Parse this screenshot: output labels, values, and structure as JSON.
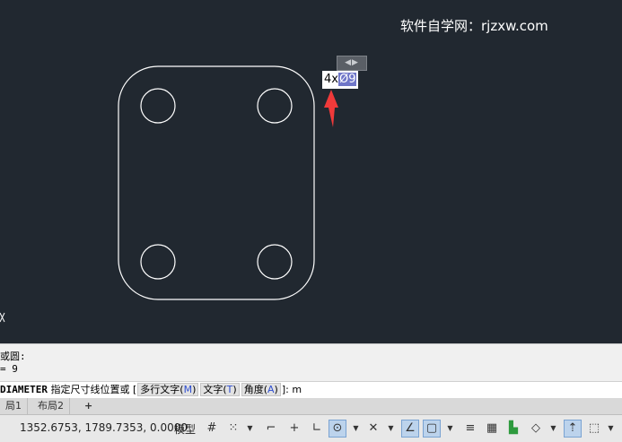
{
  "watermark": "软件自学网：rjzxw.com",
  "dimension_editor": {
    "prefix": "4x",
    "selected": "Ø9",
    "grip_glyph": "◀▶"
  },
  "command_history": {
    "line1": "或圆:",
    "line2": " = 9"
  },
  "command_input": {
    "command": "DIAMETER",
    "prompt": " 指定尺寸线位置或 [",
    "options": [
      {
        "label": "多行文字",
        "key": "M"
      },
      {
        "label": "文字",
        "key": "T"
      },
      {
        "label": "角度",
        "key": "A"
      }
    ],
    "suffix": "]: m"
  },
  "layout_tabs": [
    "局1",
    "布局2"
  ],
  "add_tab_glyph": "+",
  "status_bar": {
    "coordinates": "1352.6753, 1789.7353, 0.0000",
    "model_label": "模型",
    "icons": [
      "grid-icon",
      "snap-icon",
      "infer-icon",
      "ortho-icon",
      "polar-icon",
      "isodraft-icon",
      "osnap-tracking-icon",
      "osnap-icon",
      "lineweight-icon",
      "transparency-icon",
      "selection-cycling-icon",
      "3d-osnap-icon",
      "dynamic-ucs-icon",
      "selection-filter-icon",
      "gizmo-icon",
      "annotation-icon"
    ]
  },
  "colors": {
    "canvas": "#212830",
    "geometry": "#ffffff",
    "arrow": "#f03a3a",
    "selection": "#6f76c8"
  }
}
